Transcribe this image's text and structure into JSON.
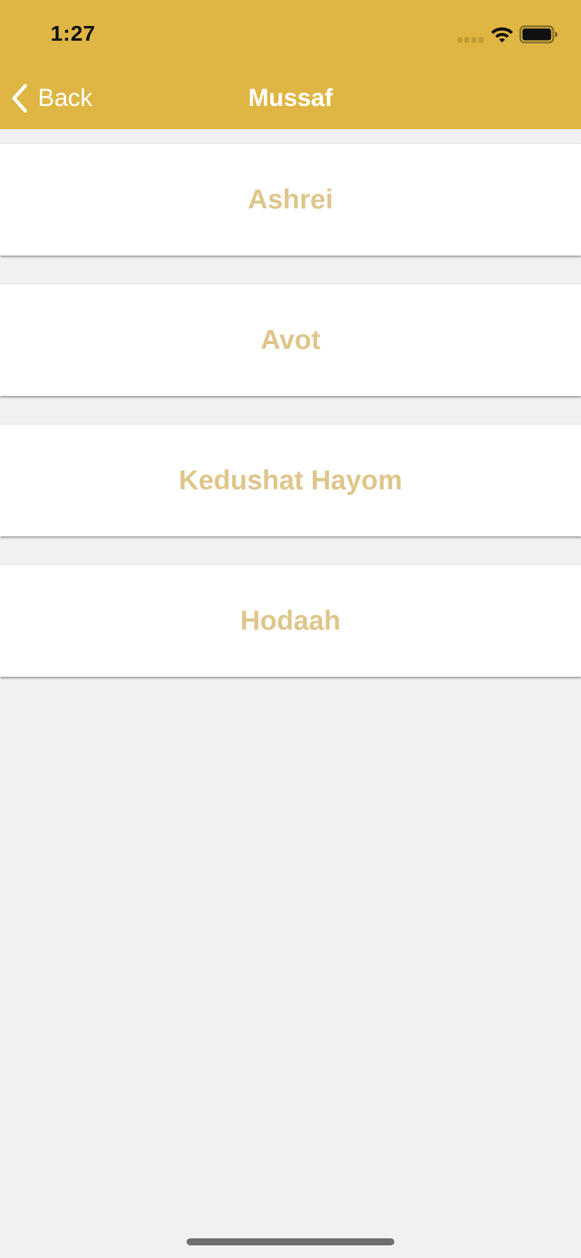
{
  "status_bar": {
    "time": "1:27"
  },
  "nav": {
    "back_label": "Back",
    "title": "Mussaf"
  },
  "list": {
    "items": [
      {
        "label": "Ashrei"
      },
      {
        "label": "Avot"
      },
      {
        "label": "Kedushat Hayom"
      },
      {
        "label": "Hodaah"
      }
    ]
  },
  "colors": {
    "header_background": "#dfb643",
    "item_text": "#dec68b",
    "page_background": "#f1f1f1"
  },
  "icons": [
    "chevron-left-icon",
    "signal-icon",
    "wifi-icon",
    "battery-icon"
  ]
}
